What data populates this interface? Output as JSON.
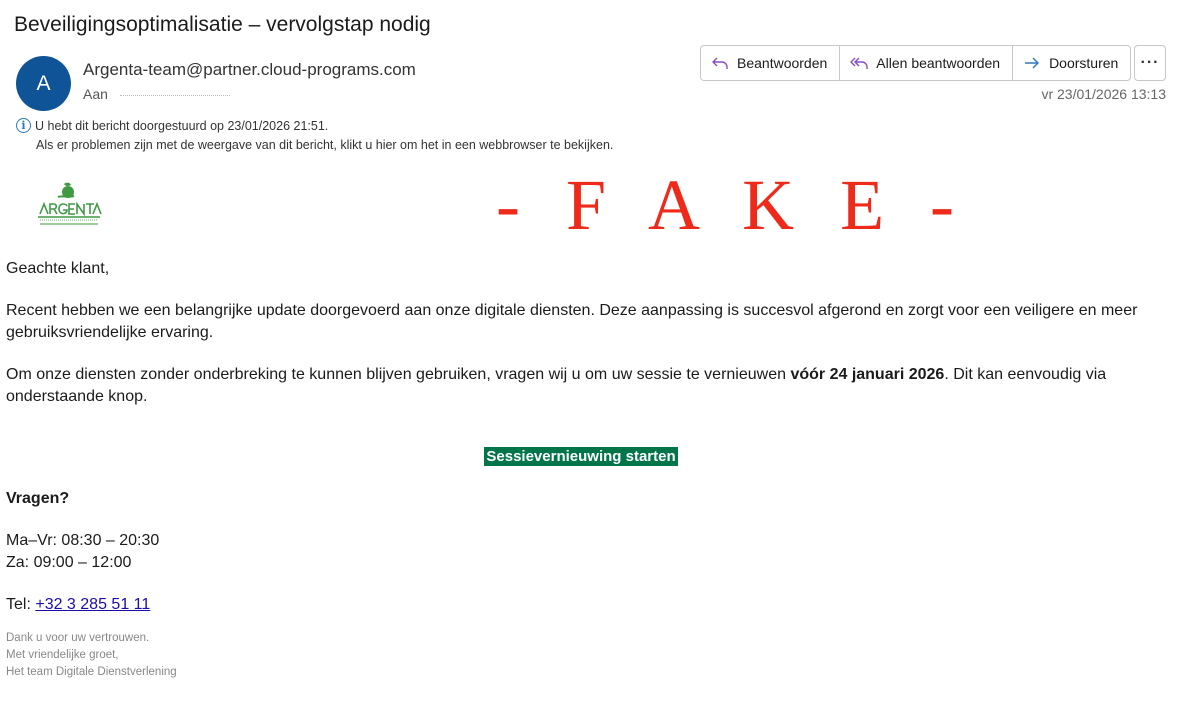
{
  "email": {
    "subject": "Beveiligingsoptimalisatie – vervolgstap nodig",
    "avatar_initial": "A",
    "sender": "Argenta-team@partner.cloud-programs.com",
    "to_label": "Aan",
    "date": "vr 23/01/2026 13:13"
  },
  "actions": {
    "reply": "Beantwoorden",
    "reply_all": "Allen beantwoorden",
    "forward": "Doorsturen",
    "more": "···"
  },
  "info": {
    "line1": "U hebt dit bericht doorgestuurd op 23/01/2026 21:51.",
    "line2": "Als er problemen zijn met de weergave van dit bericht, klikt u hier om het in een webbrowser te bekijken."
  },
  "logo": {
    "name": "ARGENTA",
    "tagline": "uw appeltje voor de dorst",
    "color": "#3f9a43"
  },
  "overlay": {
    "text": "- F A K E -",
    "color": "#ee2a1a"
  },
  "body": {
    "greeting": "Geachte klant,",
    "para1": "Recent hebben we een belangrijke update doorgevoerd aan onze digitale diensten. Deze aanpassing is succesvol afgerond en zorgt voor een veiligere en meer gebruiksvriendelijke ervaring.",
    "para2_start": "Om onze diensten zonder onderbreking te kunnen blijven gebruiken, vragen wij u om uw sessie te vernieuwen ",
    "para2_bold": "vóór 24 januari 2026",
    "para2_end": ". Dit kan eenvoudig via onderstaande knop.",
    "cta": "Sessievernieuwing starten",
    "cta_color": "#00754a",
    "questions": "Vragen?",
    "hours1": "Ma–Vr: 08:30 – 20:30",
    "hours2": "Za: 09:00 – 12:00",
    "tel_label": "Tel: ",
    "tel": "+32 3 285 51 11",
    "closing1": "Dank u voor uw vertrouwen.",
    "closing2": "Met vriendelijke groet,",
    "closing3": "Het team Digitale Dienstverlening"
  }
}
